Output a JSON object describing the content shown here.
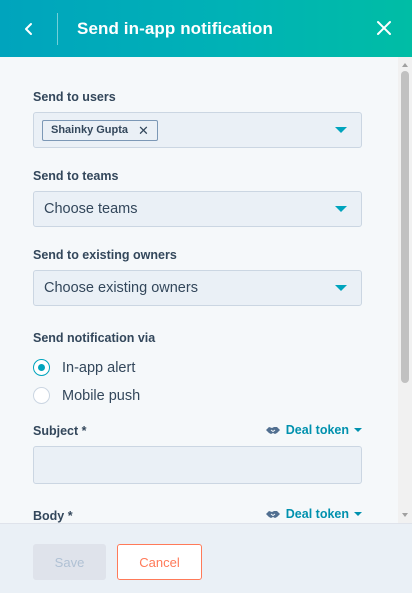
{
  "header": {
    "title": "Send in-app notification",
    "back_icon": "chevron-left-icon",
    "close_icon": "close-icon"
  },
  "form": {
    "send_to_users": {
      "label": "Send to users",
      "selected": [
        "Shainky Gupta"
      ]
    },
    "send_to_teams": {
      "label": "Send to teams",
      "placeholder": "Choose teams"
    },
    "send_to_owners": {
      "label": "Send to existing owners",
      "placeholder": "Choose existing owners"
    },
    "notification_via": {
      "label": "Send notification via",
      "options": [
        {
          "label": "In-app alert",
          "checked": true
        },
        {
          "label": "Mobile push",
          "checked": false
        }
      ]
    },
    "subject": {
      "label": "Subject *",
      "token_label": "Deal token",
      "value": ""
    },
    "body": {
      "label": "Body *",
      "token_label": "Deal token"
    }
  },
  "footer": {
    "save_label": "Save",
    "cancel_label": "Cancel"
  },
  "colors": {
    "header_gradient_start": "#00a4bd",
    "header_gradient_end": "#00bda5",
    "accent": "#00a4bd",
    "link": "#0091ae",
    "cancel": "#ff7a59"
  }
}
